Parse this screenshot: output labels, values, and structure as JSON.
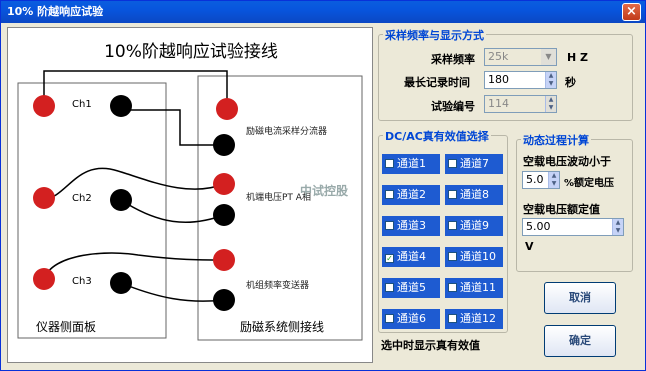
{
  "window": {
    "title": "10% 阶越响应试验",
    "close_glyph": "×"
  },
  "diagram": {
    "title": "10%阶越响应试验接线",
    "channels": [
      "Ch1",
      "Ch2",
      "Ch3"
    ],
    "right_labels": [
      "励磁电流采样分流器",
      "机端电压PT A相",
      "机组频率变送器"
    ],
    "watermark": "中试控股",
    "left_panel_caption": "仪器侧面板",
    "right_panel_caption": "励磁系统侧接线"
  },
  "sampling": {
    "group_title": "采样频率与显示方式",
    "freq_label": "采样频率",
    "freq_value": "25k",
    "freq_unit": "H Z",
    "max_time_label": "最长记录时间",
    "max_time_value": "180",
    "max_time_unit": "秒",
    "test_no_label": "试验编号",
    "test_no_value": "114"
  },
  "rms": {
    "group_title": "DC/AC真有效值选择",
    "channels": [
      {
        "label": "通道1",
        "checked": false
      },
      {
        "label": "通道7",
        "checked": false
      },
      {
        "label": "通道2",
        "checked": false
      },
      {
        "label": "通道8",
        "checked": false
      },
      {
        "label": "通道3",
        "checked": false
      },
      {
        "label": "通道9",
        "checked": false
      },
      {
        "label": "通道4",
        "checked": true
      },
      {
        "label": "通道10",
        "checked": false
      },
      {
        "label": "通道5",
        "checked": false
      },
      {
        "label": "通道11",
        "checked": false
      },
      {
        "label": "通道6",
        "checked": false
      },
      {
        "label": "通道12",
        "checked": false
      }
    ],
    "footer": "选中时显示真有效值",
    "check_mark": "✓"
  },
  "dynamic": {
    "group_title": "动态过程计算",
    "fluct_label": "空载电压波动小于",
    "fluct_value": "5.0",
    "fluct_unit": "%额定电压",
    "rated_label": "空载电压额定值",
    "rated_value": "5.00",
    "rated_unit": "V"
  },
  "buttons": {
    "cancel": "取消",
    "ok": "确定"
  },
  "glyphs": {
    "spin_up": "▲",
    "spin_down": "▼",
    "dropdown": "▼"
  }
}
